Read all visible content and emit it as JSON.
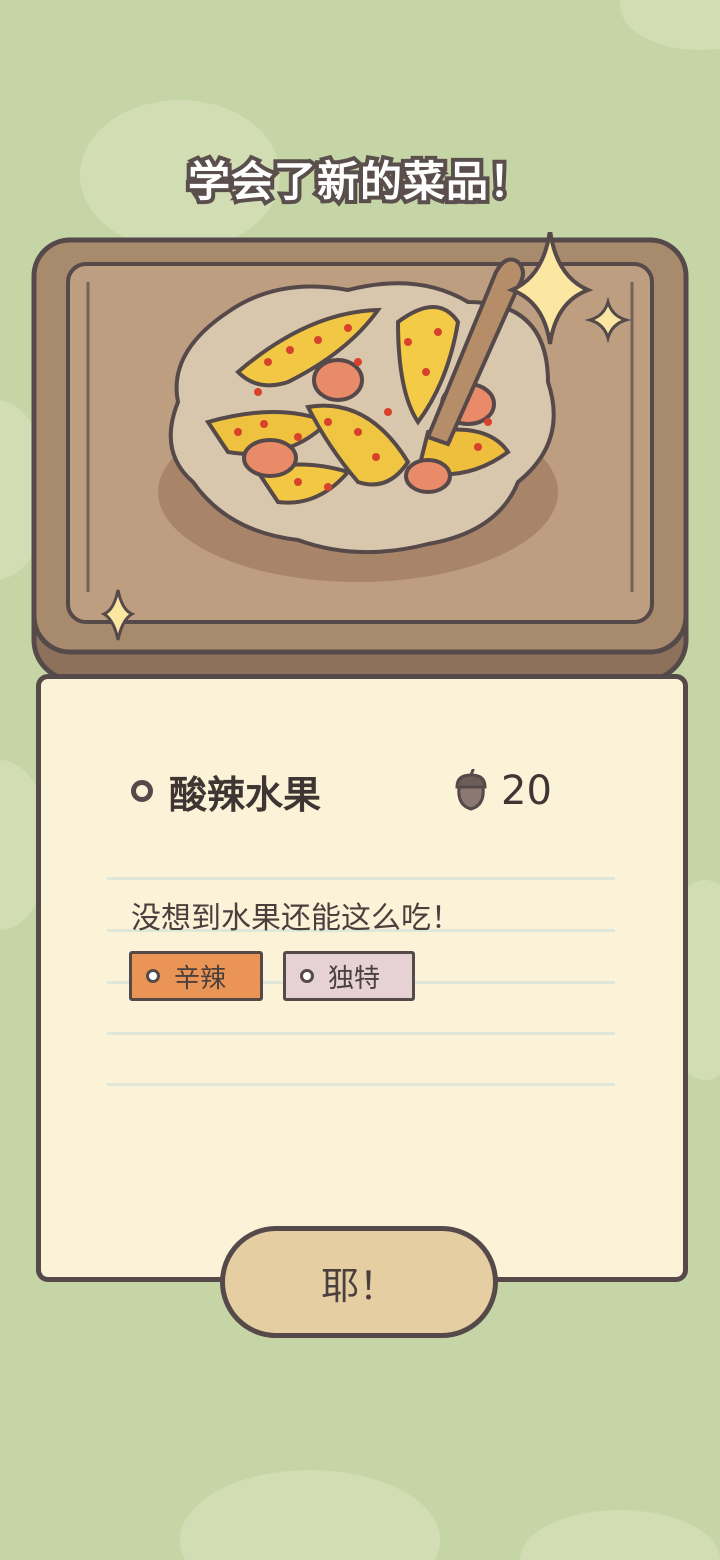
{
  "popup": {
    "title": "学会了新的菜品！"
  },
  "dish": {
    "image_icon": "spicy-fruit-dish-illustration",
    "name": "酸辣水果",
    "price_icon": "acorn-icon",
    "price": "20",
    "description": "没想到水果还能这么吃！",
    "tags": [
      {
        "label": "辛辣",
        "color": "#ea9455"
      },
      {
        "label": "独特",
        "color": "#e6d1d5"
      }
    ]
  },
  "actions": {
    "confirm_label": "耶！"
  },
  "colors": {
    "background": "#c6d5a6",
    "card": "#fbf3d8",
    "outline": "#56494a",
    "tray": "#a88a6d",
    "button": "#e5cfa2"
  }
}
